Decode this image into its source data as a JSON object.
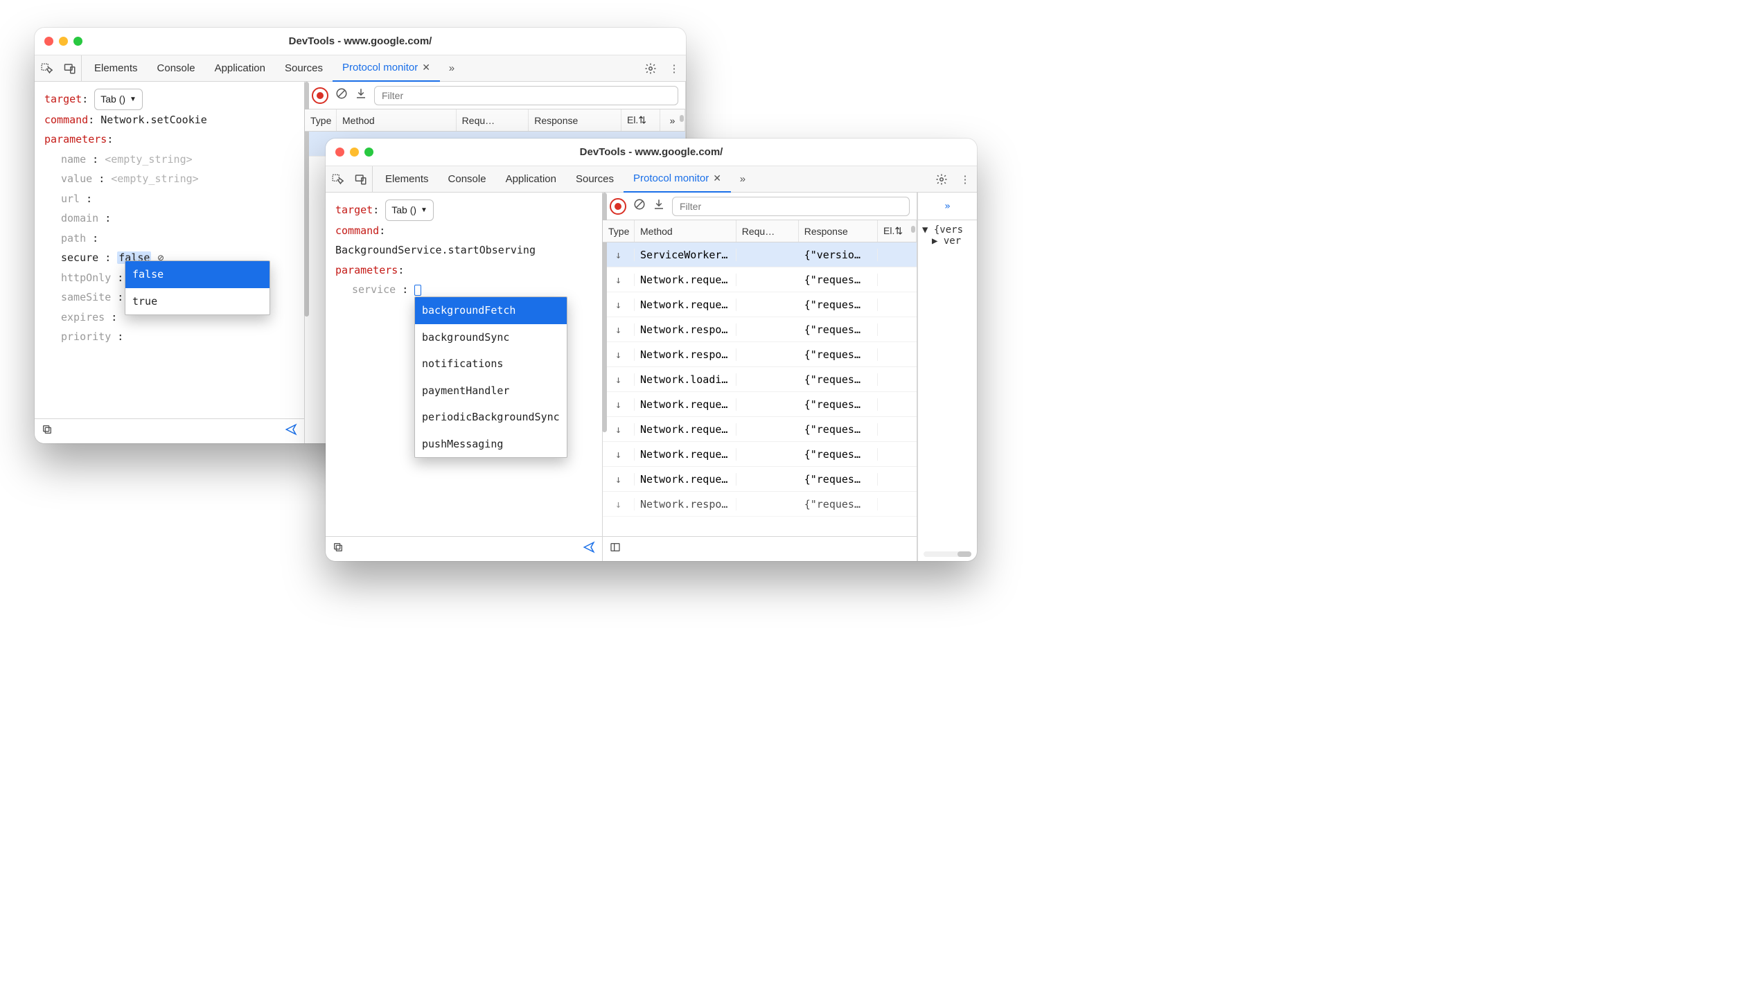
{
  "windowA": {
    "title": "DevTools - www.google.com/",
    "tabs": [
      "Elements",
      "Console",
      "Application",
      "Sources",
      "Protocol monitor"
    ],
    "activeTab": "Protocol monitor",
    "left": {
      "targetLabel": "target",
      "targetSelect": "Tab ()",
      "commandLabel": "command",
      "commandValue": "Network.setCookie",
      "parametersLabel": "parameters",
      "params": [
        {
          "key": "name",
          "value": "<empty_string>"
        },
        {
          "key": "value",
          "value": "<empty_string>"
        },
        {
          "key": "url",
          "value": ""
        },
        {
          "key": "domain",
          "value": ""
        },
        {
          "key": "path",
          "value": ""
        },
        {
          "key": "secure",
          "value": "false",
          "highlighted": true,
          "clearIcon": true
        },
        {
          "key": "httpOnly",
          "value": ""
        },
        {
          "key": "sameSite",
          "value": ""
        },
        {
          "key": "expires",
          "value": ""
        },
        {
          "key": "priority",
          "value": ""
        }
      ],
      "autocomplete": {
        "options": [
          "false",
          "true"
        ],
        "selected": "false"
      }
    },
    "right": {
      "filterPlaceholder": "Filter",
      "columns": [
        "Type",
        "Method",
        "Requ…",
        "Response",
        "El.⇅"
      ]
    }
  },
  "windowB": {
    "title": "DevTools - www.google.com/",
    "tabs": [
      "Elements",
      "Console",
      "Application",
      "Sources",
      "Protocol monitor"
    ],
    "activeTab": "Protocol monitor",
    "left": {
      "targetLabel": "target",
      "targetSelect": "Tab ()",
      "commandLabel": "command",
      "commandValue": "BackgroundService.startObserving",
      "parametersLabel": "parameters",
      "params": [
        {
          "key": "service",
          "value": "",
          "cursor": true
        }
      ],
      "autocomplete": {
        "options": [
          "backgroundFetch",
          "backgroundSync",
          "notifications",
          "paymentHandler",
          "periodicBackgroundSync",
          "pushMessaging"
        ],
        "selected": "backgroundFetch"
      }
    },
    "right": {
      "filterPlaceholder": "Filter",
      "columns": [
        "Type",
        "Method",
        "Requ…",
        "Response",
        "El.⇅"
      ],
      "rows": [
        {
          "method": "ServiceWorker…",
          "response": "{\"versio…",
          "selected": true
        },
        {
          "method": "Network.reque…",
          "response": "{\"reques…"
        },
        {
          "method": "Network.reque…",
          "response": "{\"reques…"
        },
        {
          "method": "Network.respo…",
          "response": "{\"reques…"
        },
        {
          "method": "Network.respo…",
          "response": "{\"reques…"
        },
        {
          "method": "Network.loadi…",
          "response": "{\"reques…"
        },
        {
          "method": "Network.reque…",
          "response": "{\"reques…"
        },
        {
          "method": "Network.reque…",
          "response": "{\"reques…"
        },
        {
          "method": "Network.reque…",
          "response": "{\"reques…"
        },
        {
          "method": "Network.reque…",
          "response": "{\"reques…"
        }
      ],
      "treeTop": "{vers",
      "treeChild": "ver"
    }
  }
}
